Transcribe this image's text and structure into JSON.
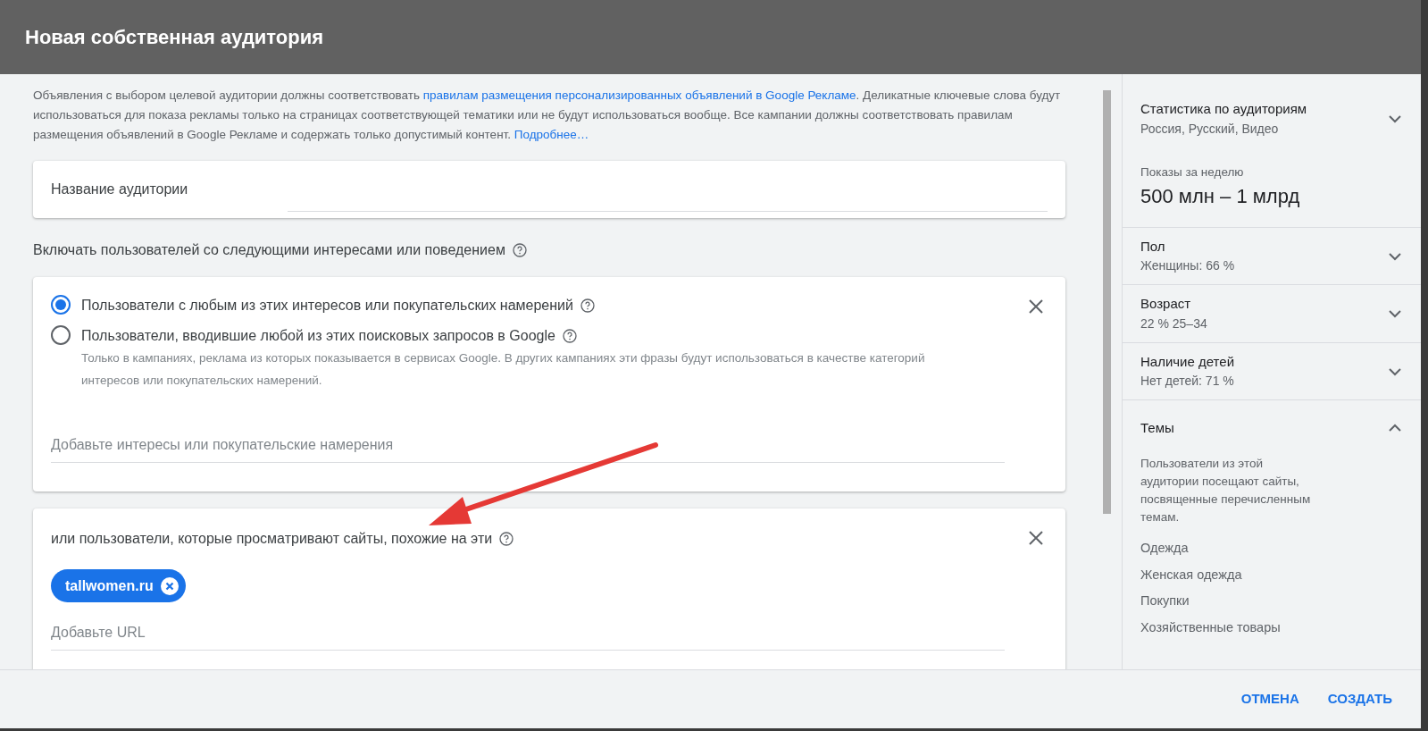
{
  "dialog": {
    "title": "Новая собственная аудитория"
  },
  "notice": [
    {
      "kind": "text",
      "text": "Объявления с выбором целевой аудитории должны соответствовать "
    },
    {
      "kind": "link",
      "text": "правилам размещения персонализированных объявлений в Google Рекламе"
    },
    {
      "kind": "text",
      "text": ". Деликатные ключевые слова будут использоваться для показа рекламы только на страницах соответствующей тематики или не будут использоваться вообще. Все кампании должны соответствовать правилам размещения объявлений в Google Рекламе и содержать только допустимый контент. "
    },
    {
      "kind": "link",
      "text": "Подробнее…"
    }
  ],
  "name_field": {
    "label": "Название аудитории"
  },
  "include_heading": "Включать пользователей со следующими интересами или поведением",
  "interests_card": {
    "options": [
      {
        "label": "Пользователи с любым из этих интересов или покупательских намерений",
        "selected": true
      },
      {
        "label": "Пользователи, вводившие любой из этих поисковых запросов в Google",
        "selected": false,
        "hint": "Только в кампаниях, реклама из которых показывается в сервисах Google. В других кампаниях эти фразы будут использоваться в качестве категорий интересов или покупательских намерений."
      }
    ],
    "placeholder": "Добавьте интересы или покупательские намерения"
  },
  "sites_card": {
    "heading": "или пользователи, которые просматривают сайты, похожие на эти",
    "chips": [
      {
        "label": "tallwomen.ru"
      }
    ],
    "placeholder": "Добавьте URL"
  },
  "side_panel": {
    "sections": [
      {
        "kind": "summary",
        "title": "Статистика по аудиториям",
        "subtitle": "Россия, Русский, Видео",
        "expanded": false,
        "metric_label": "Показы за неделю",
        "metric_value": "500 млн – 1 млрд"
      },
      {
        "kind": "row",
        "title": "Пол",
        "subtitle": "Женщины: 66 %",
        "expanded": false
      },
      {
        "kind": "row",
        "title": "Возраст",
        "subtitle": "22 % 25–34",
        "expanded": false
      },
      {
        "kind": "row",
        "title": "Наличие детей",
        "subtitle": "Нет детей: 71 %",
        "expanded": false
      },
      {
        "kind": "topics",
        "title": "Темы",
        "expanded": true,
        "description": "Пользователи из этой аудитории посещают сайты, посвященные перечисленным темам.",
        "items": [
          "Одежда",
          "Женская одежда",
          "Покупки",
          "Хозяйственные товары"
        ]
      }
    ]
  },
  "footer": {
    "buttons": [
      {
        "label": "ОТМЕНА"
      },
      {
        "label": "СОЗДАТЬ"
      }
    ]
  }
}
